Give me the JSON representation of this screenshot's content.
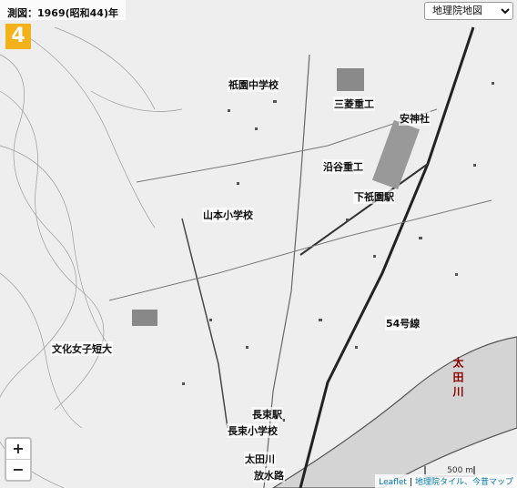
{
  "survey": {
    "label": "測図：1969(昭和44)年"
  },
  "badge": {
    "number": "4"
  },
  "layer_select": {
    "selected": "地理院地図"
  },
  "labels": {
    "gion_jhs": "祇園中学校",
    "mitsubishi": "三菱重工",
    "anjin": "安神社",
    "sanotani": "沿谷重工",
    "shimogion": "下祇園駅",
    "yamamoto": "山本小学校",
    "route54": "54号線",
    "bunka": "文化女子短大",
    "nagatsuka_st": "長束駅",
    "nagatsuka_es": "長束小学校",
    "ota_floodway_1": "太田川",
    "ota_floodway_2": "放水路",
    "ota_river": "太田川"
  },
  "zoom": {
    "in": "+",
    "out": "−"
  },
  "scale": {
    "label": "500 m"
  },
  "attribution": {
    "leaflet": "Leaflet",
    "sep": "|",
    "source": "地理院タイル、今昔マップ"
  }
}
